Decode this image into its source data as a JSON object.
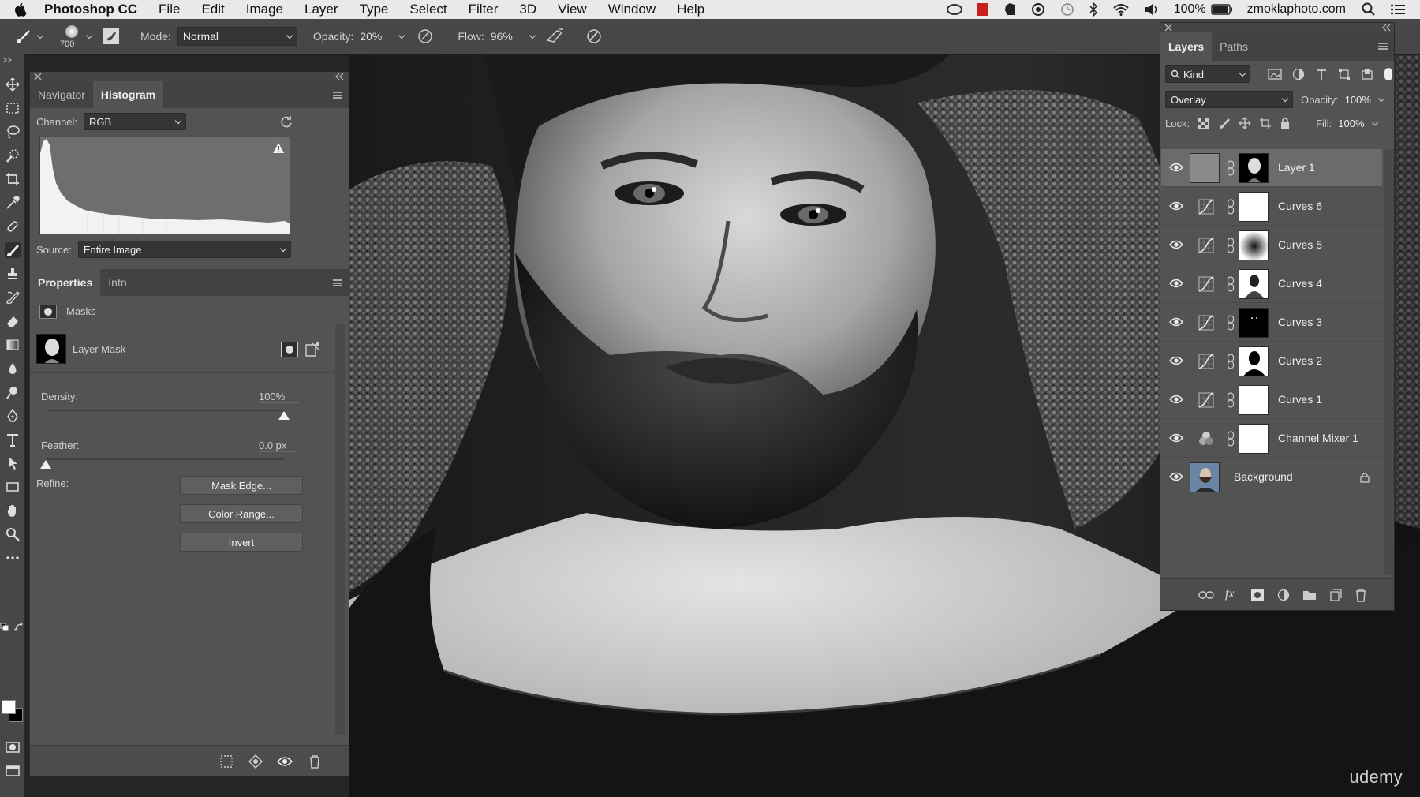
{
  "menubar": {
    "app_name": "Photoshop CC",
    "items": [
      "File",
      "Edit",
      "Image",
      "Layer",
      "Type",
      "Select",
      "Filter",
      "3D",
      "View",
      "Window",
      "Help"
    ],
    "battery": "100%",
    "site": "zmoklaphoto.com"
  },
  "options": {
    "brush_size": "700",
    "mode_label": "Mode:",
    "mode_value": "Normal",
    "opacity_label": "Opacity:",
    "opacity_value": "20%",
    "flow_label": "Flow:",
    "flow_value": "96%"
  },
  "histogram": {
    "tabs": [
      "Navigator",
      "Histogram"
    ],
    "active_tab": "Histogram",
    "channel_label": "Channel:",
    "channel_value": "RGB",
    "source_label": "Source:",
    "source_value": "Entire Image"
  },
  "properties": {
    "tabs": [
      "Properties",
      "Info"
    ],
    "active_tab": "Properties",
    "section": "Masks",
    "mask_label": "Layer Mask",
    "density_label": "Density:",
    "density_value": "100%",
    "density": 1.0,
    "feather_label": "Feather:",
    "feather_value": "0.0 px",
    "feather": 0.0,
    "refine_label": "Refine:",
    "buttons": [
      "Mask Edge...",
      "Color Range...",
      "Invert"
    ]
  },
  "layers": {
    "tabs": [
      "Layers",
      "Paths"
    ],
    "active_tab": "Layers",
    "filter_value": "Kind",
    "blend_mode": "Overlay",
    "opacity_label": "Opacity:",
    "opacity_value": "100%",
    "lock_label": "Lock:",
    "fill_label": "Fill:",
    "fill_value": "100%",
    "items": [
      {
        "name": "Layer 1",
        "kind": "pixel",
        "selected": true
      },
      {
        "name": "Curves 6",
        "kind": "curves",
        "selected": false
      },
      {
        "name": "Curves 5",
        "kind": "curves",
        "selected": false
      },
      {
        "name": "Curves 4",
        "kind": "curves",
        "selected": false
      },
      {
        "name": "Curves 3",
        "kind": "curves",
        "selected": false
      },
      {
        "name": "Curves 2",
        "kind": "curves",
        "selected": false
      },
      {
        "name": "Curves 1",
        "kind": "curves",
        "selected": false
      },
      {
        "name": "Channel Mixer 1",
        "kind": "channel-mixer",
        "selected": false
      },
      {
        "name": "Background",
        "kind": "background",
        "selected": false,
        "locked": true
      }
    ]
  },
  "watermark": "udemy",
  "colors": {
    "panel": "#535353",
    "panel_dark": "#424242",
    "menubar": "#e9e9e9",
    "selected_row": "#6b6b6b"
  }
}
